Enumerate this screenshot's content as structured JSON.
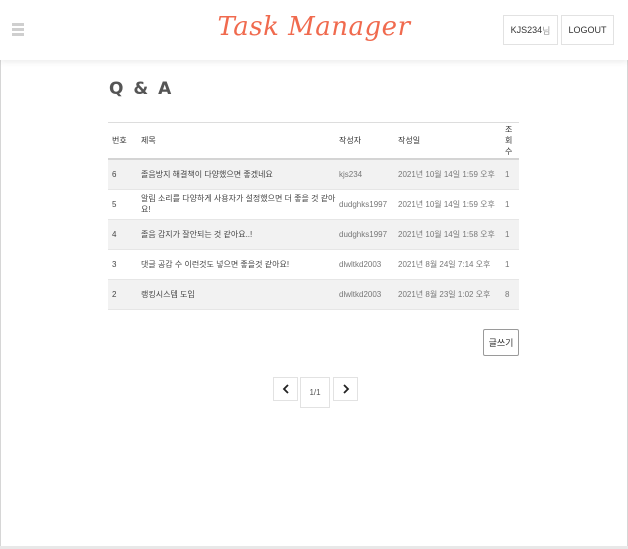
{
  "header": {
    "brand": "Task Manager",
    "user_id": "KJS234",
    "user_suffix": "님",
    "logout_label": "LOGOUT"
  },
  "page": {
    "title": "Q & A"
  },
  "table": {
    "columns": [
      "번호",
      "제목",
      "작성자",
      "작성일",
      "조회수"
    ],
    "rows": [
      {
        "no": "6",
        "title": "졸음방지 해결책이 다양했으면 좋겠네요",
        "writer": "kjs234",
        "date": "2021년 10월 14일 1:59 오후",
        "views": "1"
      },
      {
        "no": "5",
        "title": "알림 소리를 다양하게 사용자가 설정했으면 더 좋을 것 같아요!",
        "writer": "dudghks1997",
        "date": "2021년 10월 14일 1:59 오후",
        "views": "1"
      },
      {
        "no": "4",
        "title": "졸음 감지가 잘안되는 것 같아요..!",
        "writer": "dudghks1997",
        "date": "2021년 10월 14일 1:58 오후",
        "views": "1"
      },
      {
        "no": "3",
        "title": "댓글 공감 수 이런것도 넣으면 좋을것 같아요!",
        "writer": "dlwltkd2003",
        "date": "2021년 8월 24일 7:14 오후",
        "views": "1"
      },
      {
        "no": "2",
        "title": "랭킹시스템 도입",
        "writer": "dlwltkd2003",
        "date": "2021년 8월 23일 1:02 오후",
        "views": "8"
      }
    ]
  },
  "actions": {
    "write_label": "글쓰기"
  },
  "pagination": {
    "indicator": "1/1",
    "prev_icon": "chevron-left-icon",
    "next_icon": "chevron-right-icon"
  },
  "colors": {
    "brand": "#f06a4e",
    "row_stripe": "#f2f2f2"
  }
}
